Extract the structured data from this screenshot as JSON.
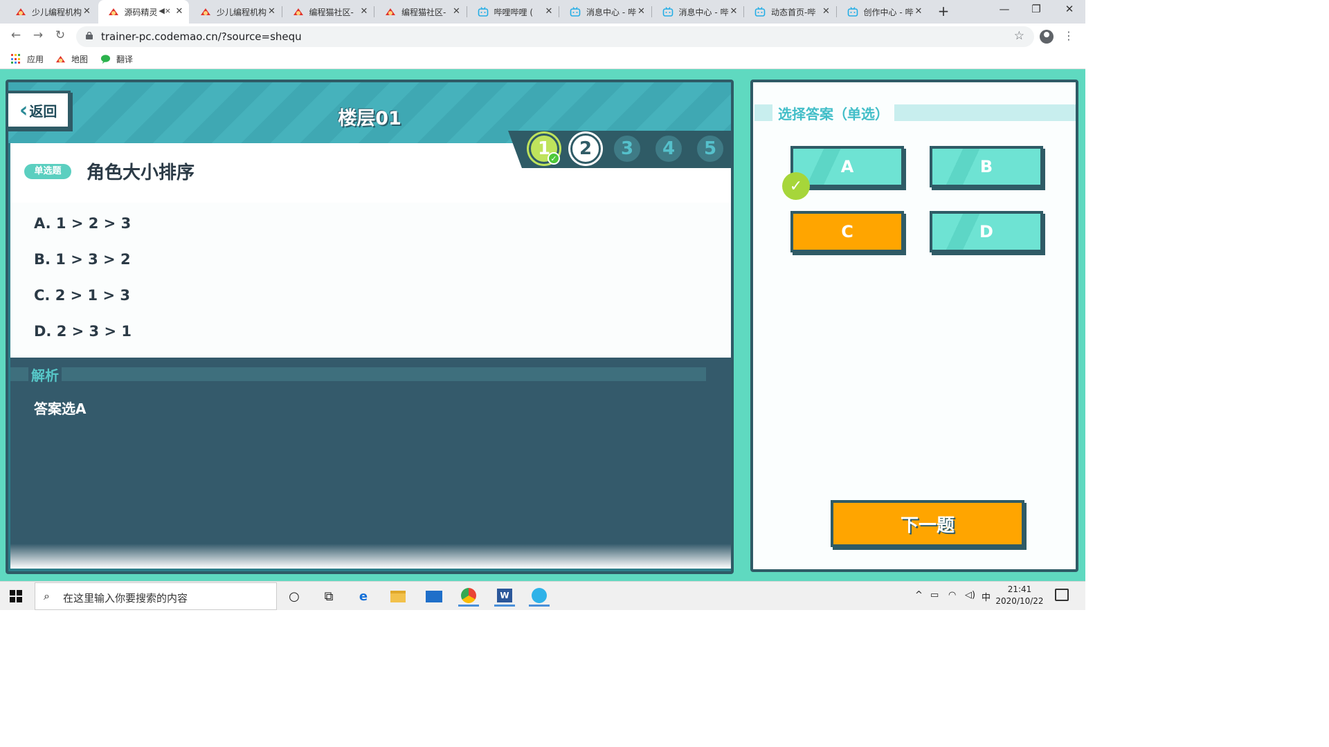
{
  "browser": {
    "tabs": [
      {
        "title": "少儿编程机构",
        "icon": "codemao-icon"
      },
      {
        "title": "源码精灵",
        "icon": "codemao-icon",
        "active": true,
        "muted": true
      },
      {
        "title": "少儿编程机构",
        "icon": "codemao-icon"
      },
      {
        "title": "编程猫社区-",
        "icon": "codemao-icon"
      },
      {
        "title": "编程猫社区-",
        "icon": "codemao-icon"
      },
      {
        "title": "哔哩哔哩 (",
        "icon": "bilibili-icon"
      },
      {
        "title": "消息中心 - 哔",
        "icon": "bilibili-icon"
      },
      {
        "title": "消息中心 - 哔",
        "icon": "bilibili-icon"
      },
      {
        "title": "动态首页-哔",
        "icon": "bilibili-icon"
      },
      {
        "title": "创作中心 - 哔",
        "icon": "bilibili-icon"
      }
    ],
    "url": "trainer-pc.codemao.cn/?source=shequ",
    "bookmarks": [
      {
        "label": "应用"
      },
      {
        "label": "地图"
      },
      {
        "label": "翻译"
      }
    ]
  },
  "quiz": {
    "back_label": "返回",
    "floor_title": "楼层01",
    "steps": [
      {
        "label": "1",
        "state": "done"
      },
      {
        "label": "2",
        "state": "current"
      },
      {
        "label": "3",
        "state": "todo"
      },
      {
        "label": "4",
        "state": "todo"
      },
      {
        "label": "5",
        "state": "todo"
      }
    ],
    "question_type": "单选题",
    "question_title": "角色大小排序",
    "options": [
      {
        "label": "A.  1 > 2 > 3"
      },
      {
        "label": "B.  1 > 3 > 2"
      },
      {
        "label": "C.  2 > 1 > 3"
      },
      {
        "label": "D.  2 > 3 > 1"
      }
    ],
    "analysis_title": "解析",
    "analysis_text": "答案选A"
  },
  "answer_panel": {
    "title": "选择答案（单选）",
    "choices": [
      {
        "label": "A",
        "style": "teal",
        "correct": true
      },
      {
        "label": "B",
        "style": "teal"
      },
      {
        "label": "C",
        "style": "orange",
        "selected": true
      },
      {
        "label": "D",
        "style": "teal"
      }
    ],
    "next_label": "下一题"
  },
  "taskbar": {
    "search_placeholder": "在这里输入你要搜索的内容",
    "ime": "中",
    "time": "21:41",
    "date": "2020/10/22"
  },
  "colors": {
    "page_bg": "#5fd9c0",
    "panel_border": "#2f5b66",
    "accent_orange": "#ffa500",
    "answer_teal": "#6ee3d3"
  }
}
